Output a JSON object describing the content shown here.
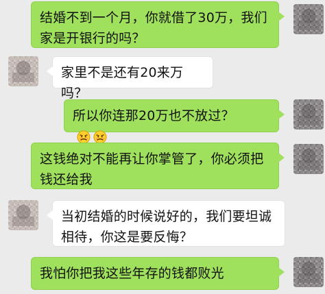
{
  "chat": {
    "messages": [
      {
        "sender": "self",
        "text": "结婚不到一个月，你就借了30万，我们家是开银行的吗？"
      },
      {
        "sender": "other",
        "text": "家里不是还有20来万吗？"
      },
      {
        "sender": "self",
        "text": "所以你连那20万也不放过？",
        "emoji": [
          "angry-emoji",
          "angry-emoji"
        ]
      },
      {
        "sender": "self",
        "text": "这钱绝对不能再让你掌管了，你必须把钱还给我"
      },
      {
        "sender": "other",
        "text": "当初结婚的时候说好的，我们要坦诚相待，你这是要反悔？"
      },
      {
        "sender": "self",
        "text": "我怕你把我这些年存的钱都败光"
      }
    ]
  }
}
